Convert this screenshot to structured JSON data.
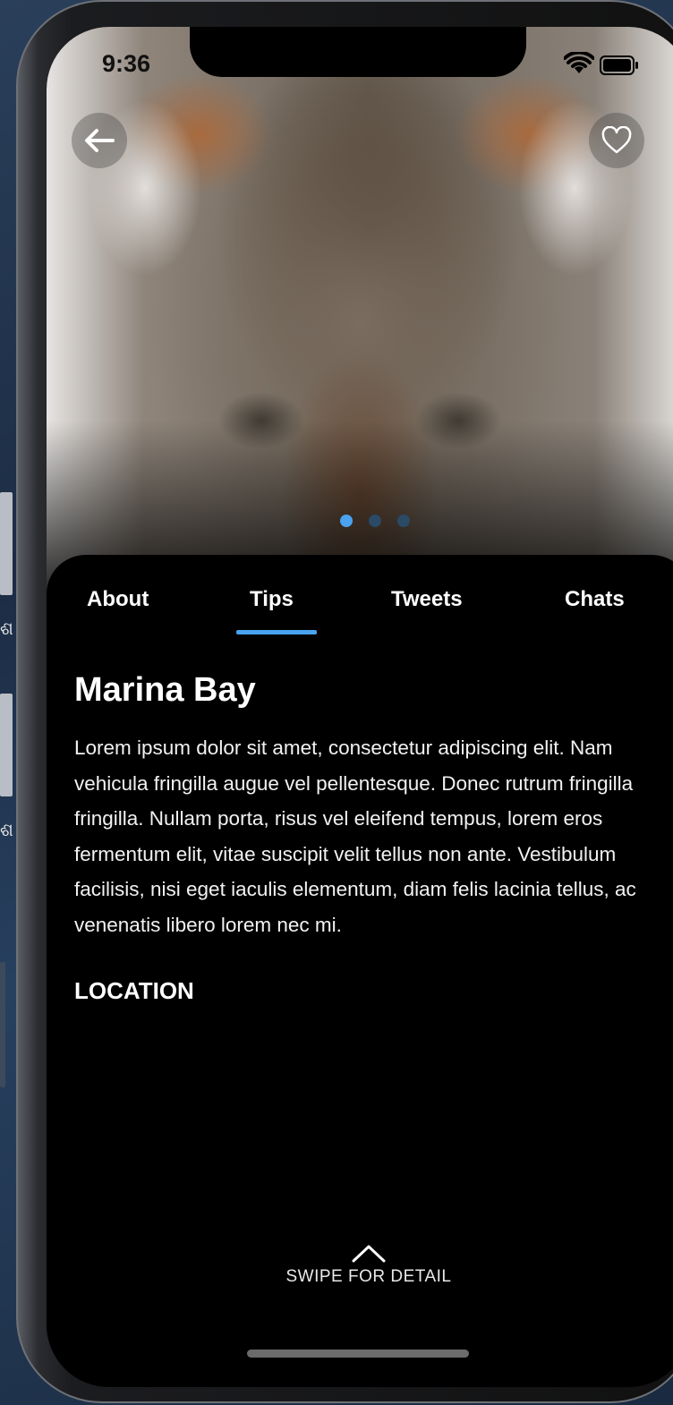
{
  "status_bar": {
    "time": "9:36"
  },
  "hero": {
    "page_count": 3,
    "active_page": 1
  },
  "tabs": [
    {
      "label": "About"
    },
    {
      "label": "Tips",
      "active": true
    },
    {
      "label": "Tweets"
    },
    {
      "label": "Chats"
    }
  ],
  "content": {
    "title": "Marina Bay",
    "description": "Lorem ipsum dolor sit amet, consectetur adipiscing elit. Nam vehicula fringilla augue vel pellentesque. Donec rutrum fringilla fringilla. Nullam porta, risus vel eleifend tempus, lorem eros fermentum elit, vitae suscipit velit tellus non ante. Vestibulum facilisis, nisi eget iaculis elementum, diam felis lacinia tellus, ac venenatis libero lorem nec mi.",
    "location_label": "LOCATION"
  },
  "footer": {
    "swipe_label": "SWIPE FOR DETAIL"
  },
  "icons": {
    "back": "arrow-left-icon",
    "favorite": "heart-outline-icon",
    "wifi": "wifi-icon",
    "battery": "battery-icon",
    "swipe": "chevron-up-icon"
  },
  "colors": {
    "accent": "#4aa3f0",
    "background": "#000000",
    "text": "#ffffff"
  }
}
